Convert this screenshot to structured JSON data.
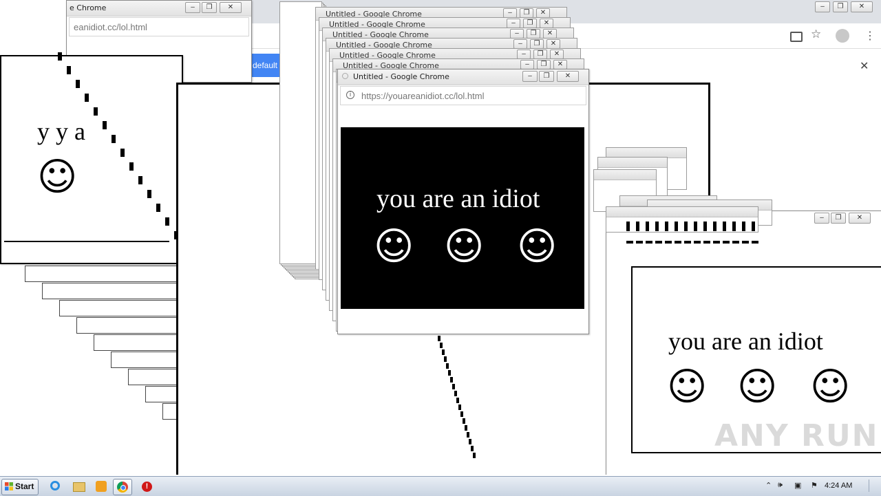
{
  "window_title": "Untitled - Google Chrome",
  "window_title_partial": "e Chrome",
  "url": "https://youareanidiot.cc/lol.html",
  "url_fragment": "eanidiot.cc/lol.html",
  "url_fragment_small": "eanidiot.cc",
  "popup_message": "you are an idiot",
  "popup_message_partial": "y y a",
  "smiley": "☺",
  "default_button": "default",
  "close_glyph": "✕",
  "ghost_titles": [
    "Untitled - Google Chrome",
    "Untitled - Google Chrome",
    "Untitled - Google Chrome",
    "Untitled - Google Chrome",
    "Untitled - Google Chrome",
    "Untitled - Google Chrome",
    "Untitled - Google Chrome"
  ],
  "taskbar": {
    "start_label": "Start",
    "clock": "4:24 AM",
    "icons": [
      "ie-icon",
      "explorer-icon",
      "media-player-icon",
      "chrome-icon",
      "stop-icon"
    ]
  },
  "watermark": "ANY RUN",
  "colors": {
    "black_panel": "#000000",
    "taskbar": "#d4dde9",
    "chrome_blue": "#4285f4"
  }
}
